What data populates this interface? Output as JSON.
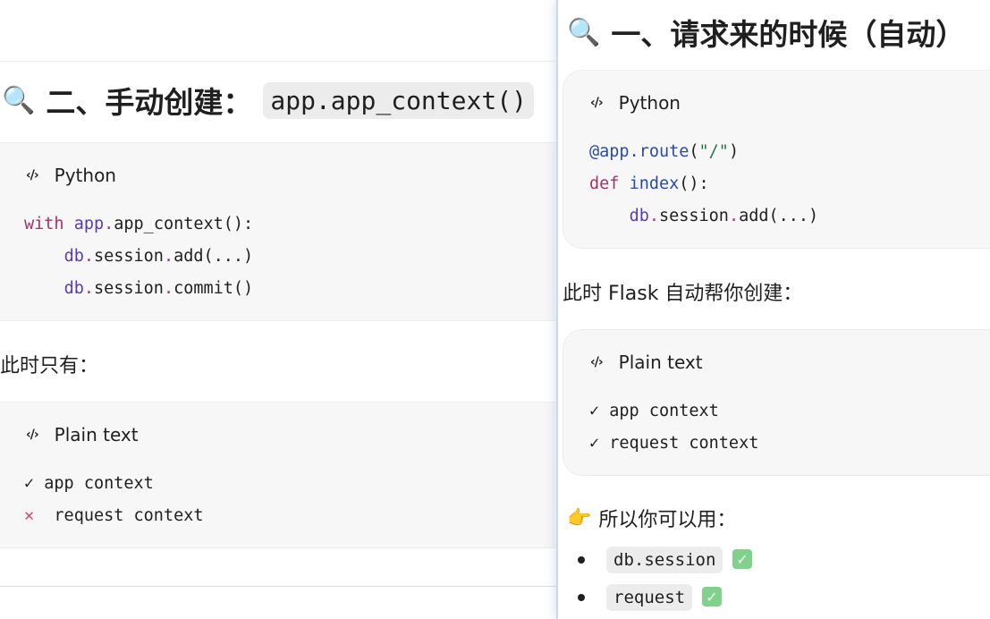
{
  "left": {
    "heading": {
      "emoji": "🔍",
      "text": "二、手动创建：",
      "code": "app.app_context()"
    },
    "python_card": {
      "lang": "Python",
      "line1": {
        "kw": "with",
        "obj": "app",
        "dot": ".",
        "rest": "app_context():"
      },
      "line2": {
        "obj": "db",
        "dot": ".",
        "mid": "session",
        "dot2": ".",
        "rest": "add(...)"
      },
      "line3": {
        "obj": "db",
        "dot": ".",
        "mid": "session",
        "dot2": ".",
        "rest": "commit()"
      }
    },
    "para": "此时只有：",
    "plain_card": {
      "lang": "Plain text",
      "item1": {
        "mark": "✓",
        "text": "app context"
      },
      "item2": {
        "mark": "✕",
        "text": "request context"
      }
    }
  },
  "right": {
    "heading": {
      "emoji": "🔍",
      "text": "一、请求来的时候（自动）"
    },
    "python_card": {
      "lang": "Python",
      "line1": {
        "deco": "@app.route",
        "open": "(",
        "str": "\"/\"",
        "close": ")"
      },
      "line2": {
        "kw": "def",
        "fn": "index",
        "rest": "():"
      },
      "line3": {
        "obj": "db",
        "dot": ".",
        "mid": "session",
        "dot2": ".",
        "rest": "add(...)"
      }
    },
    "para": "此时 Flask 自动帮你创建：",
    "plain_card": {
      "lang": "Plain text",
      "item1": {
        "mark": "✓",
        "text": "app context"
      },
      "item2": {
        "mark": "✓",
        "text": "request context"
      }
    },
    "pointer": {
      "emoji": "👉",
      "text": "所以你可以用："
    },
    "bullets": [
      {
        "code": "db.session",
        "badge": "✓"
      },
      {
        "code": "request",
        "badge": "✓"
      }
    ]
  },
  "icons": {
    "code_icon": "‹/›"
  }
}
